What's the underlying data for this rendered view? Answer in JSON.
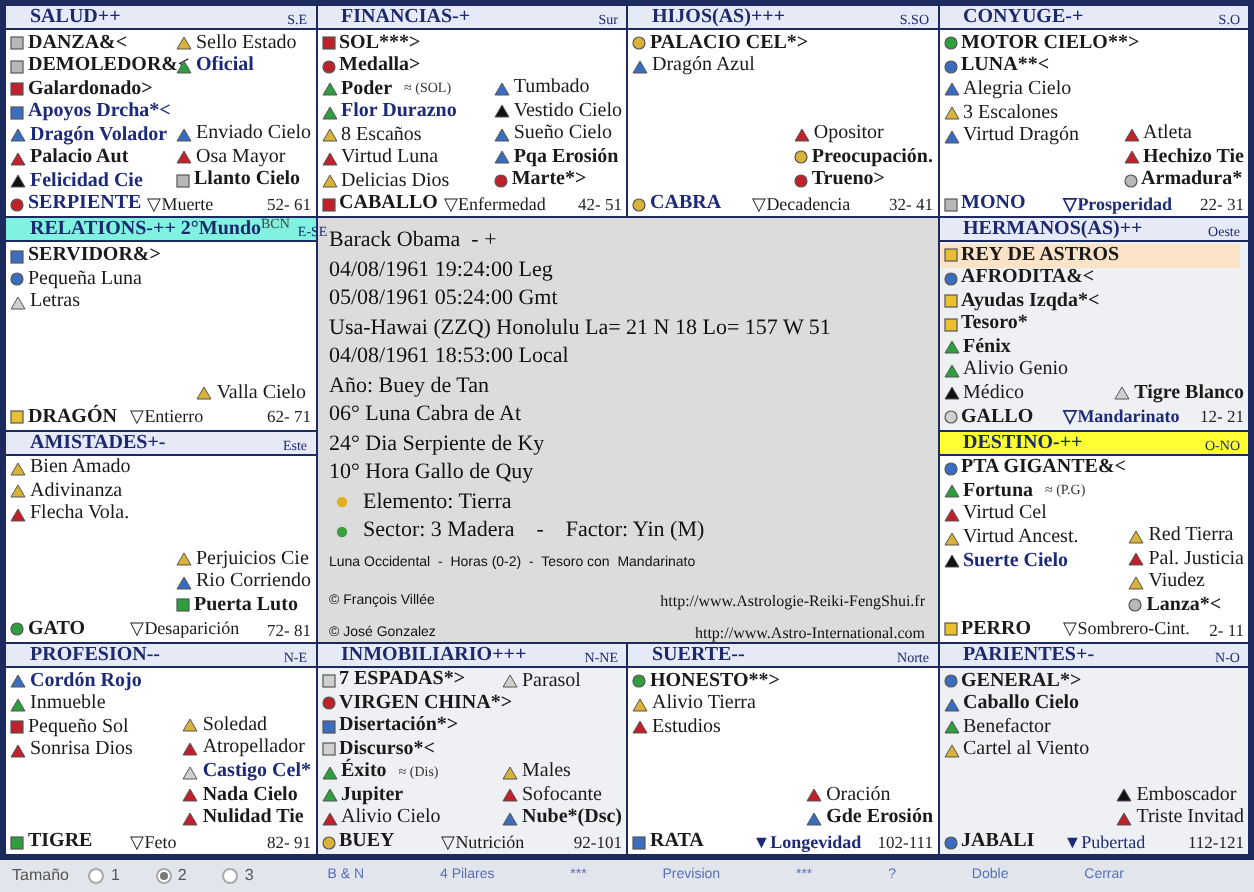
{
  "palaces": [
    {
      "title": "SALUD++",
      "direction": "S.E",
      "color": "#e6eaf7",
      "shaded": false,
      "left": [
        {
          "text": "DANZA&<",
          "kind": "square",
          "color": "#b8b8b8",
          "major": true,
          "accent": false
        },
        {
          "text": "DEMOLEDOR&<",
          "kind": "square",
          "color": "#b8b8b8",
          "major": true,
          "accent": false
        },
        {
          "text": "Galardonado>",
          "kind": "square",
          "color": "#c0202a",
          "major": true,
          "accent": false
        },
        {
          "text": "Apoyos Drcha*<",
          "kind": "square",
          "color": "#3a6cc0",
          "major": true,
          "accent": true
        },
        {
          "text": "Dragón Volador",
          "kind": "triangle",
          "color": "#3a6cc0",
          "major": true,
          "accent": true
        },
        {
          "text": "Palacio Aut",
          "kind": "triangle",
          "color": "#c0202a",
          "major": true,
          "accent": false
        },
        {
          "text": "Felicidad Cie",
          "kind": "triangle",
          "color": "#111111",
          "major": true,
          "accent": true
        }
      ],
      "right_top": [
        {
          "text": "Sello Estado",
          "kind": "triangle",
          "color": "#d9b23a",
          "major": false,
          "accent": false
        },
        {
          "text": "Oficial",
          "kind": "triangle",
          "color": "#2e9e3e",
          "major": true,
          "accent": true
        }
      ],
      "right_bottom": [
        {
          "text": "Enviado Cielo",
          "kind": "triangle",
          "color": "#3a6cc0",
          "major": false,
          "accent": false
        },
        {
          "text": "Osa Mayor",
          "kind": "triangle",
          "color": "#c0202a",
          "major": false,
          "accent": false
        },
        {
          "text": "Llanto Cielo",
          "kind": "square",
          "color": "#b8b8b8",
          "major": true,
          "accent": false
        }
      ],
      "footer": {
        "animal": {
          "text": "SERPIENTE",
          "kind": "circle",
          "color": "#c0202a",
          "major": true,
          "accent": true
        },
        "stage": {
          "text": "▽Muerte",
          "major": false,
          "accent": false
        },
        "range": "52- 61"
      }
    },
    {
      "title": "FINANCIAS-+",
      "direction": "Sur",
      "color": "#e6eaf7",
      "shaded": false,
      "left": [
        {
          "text": "SOL***>",
          "kind": "square",
          "color": "#c0202a",
          "major": true,
          "accent": false
        },
        {
          "text": "Medalla>",
          "kind": "circle",
          "color": "#c0202a",
          "major": true,
          "accent": false
        },
        {
          "text": "Poder",
          "kind": "triangle",
          "color": "#2e9e3e",
          "major": true,
          "accent": false,
          "note": "≈ (SOL)"
        },
        {
          "text": "Flor Durazno",
          "kind": "triangle",
          "color": "#2e9e3e",
          "major": true,
          "accent": true
        },
        {
          "text": "8 Escaños",
          "kind": "triangle",
          "color": "#d9b23a",
          "major": false,
          "accent": false
        },
        {
          "text": "Virtud Luna",
          "kind": "triangle",
          "color": "#c0202a",
          "major": false,
          "accent": false
        },
        {
          "text": "Delicias Dios",
          "kind": "triangle",
          "color": "#d9b23a",
          "major": false,
          "accent": false
        }
      ],
      "right_bottom": [
        {
          "text": "Tumbado",
          "kind": "triangle",
          "color": "#3a6cc0",
          "major": false,
          "accent": false
        },
        {
          "text": "Vestido Cielo",
          "kind": "triangle",
          "color": "#111111",
          "major": false,
          "accent": false
        },
        {
          "text": "Sueño Cielo",
          "kind": "triangle",
          "color": "#3a6cc0",
          "major": false,
          "accent": false
        },
        {
          "text": "Pqa Erosión",
          "kind": "triangle",
          "color": "#3a6cc0",
          "major": true,
          "accent": false
        },
        {
          "text": "Marte*>",
          "kind": "circle",
          "color": "#c0202a",
          "major": true,
          "accent": false
        }
      ],
      "footer": {
        "animal": {
          "text": "CABALLO",
          "kind": "square",
          "color": "#c0202a",
          "major": true,
          "accent": false
        },
        "stage": {
          "text": "▽Enfermedad",
          "major": false,
          "accent": false
        },
        "range": "42- 51"
      }
    },
    {
      "title": "HIJOS(AS)+++",
      "direction": "S.SO",
      "color": "#e6eaf7",
      "shaded": false,
      "left": [
        {
          "text": "PALACIO CEL*>",
          "kind": "circle",
          "color": "#d9b23a",
          "major": true,
          "accent": false
        },
        {
          "text": "Dragón Azul",
          "kind": "triangle",
          "color": "#3a6cc0",
          "major": false,
          "accent": false
        }
      ],
      "right_bottom": [
        {
          "text": "Opositor",
          "kind": "triangle",
          "color": "#c0202a",
          "major": false,
          "accent": false
        },
        {
          "text": "Preocupación.",
          "kind": "circle",
          "color": "#d9b23a",
          "major": true,
          "accent": false
        },
        {
          "text": "Trueno>",
          "kind": "circle",
          "color": "#c0202a",
          "major": true,
          "accent": false
        }
      ],
      "footer": {
        "animal": {
          "text": "CABRA",
          "kind": "circle",
          "color": "#d9b23a",
          "major": true,
          "accent": true
        },
        "stage": {
          "text": "▽Decadencia",
          "major": false,
          "accent": false
        },
        "range": "32- 41"
      }
    },
    {
      "title": "CONYUGE-+",
      "direction": "S.O",
      "color": "#e6eaf7",
      "shaded": false,
      "left": [
        {
          "text": "MOTOR CIELO**>",
          "kind": "circle",
          "color": "#2e9e3e",
          "major": true,
          "accent": false
        },
        {
          "text": "LUNA**<",
          "kind": "circle",
          "color": "#3a6cc0",
          "major": true,
          "accent": false
        },
        {
          "text": "Alegria Cielo",
          "kind": "triangle",
          "color": "#3a6cc0",
          "major": false,
          "accent": false
        },
        {
          "text": "3 Escalones",
          "kind": "triangle",
          "color": "#d9b23a",
          "major": false,
          "accent": false
        },
        {
          "text": "Virtud Dragón",
          "kind": "triangle",
          "color": "#3a6cc0",
          "major": false,
          "accent": false
        }
      ],
      "right_bottom": [
        {
          "text": "Atleta",
          "kind": "triangle",
          "color": "#c0202a",
          "major": false,
          "accent": false
        },
        {
          "text": "Hechizo Tie",
          "kind": "triangle",
          "color": "#c0202a",
          "major": true,
          "accent": false
        },
        {
          "text": "Armadura*",
          "kind": "circle",
          "color": "#b8b8b8",
          "major": true,
          "accent": false
        }
      ],
      "footer": {
        "animal": {
          "text": "MONO",
          "kind": "square",
          "color": "#b8b8b8",
          "major": true,
          "accent": true
        },
        "stage": {
          "text": "▽Prosperidad",
          "major": true,
          "accent": true
        },
        "range": "22- 31"
      }
    },
    {
      "title": "RELATIONS-++ 2°Mundo",
      "direction": "E-SE",
      "color": "#7ff3df",
      "shaded": false,
      "badge": "BCN",
      "left": [
        {
          "text": "SERVIDOR&>",
          "kind": "square",
          "color": "#3a6cc0",
          "major": true,
          "accent": false
        },
        {
          "text": "Pequeña Luna",
          "kind": "circle",
          "color": "#3a6cc0",
          "major": false,
          "accent": false
        },
        {
          "text": "Letras",
          "kind": "triangle",
          "color": "#d0d0d0",
          "major": false,
          "accent": false
        }
      ],
      "right_bottom": [
        {
          "text": "Valla Cielo",
          "kind": "triangle",
          "color": "#d9b23a",
          "major": false,
          "accent": false
        }
      ],
      "footer": {
        "animal": {
          "text": "DRAGÓN",
          "kind": "square",
          "color": "#e8c030",
          "major": true,
          "accent": false
        },
        "stage": {
          "text": "▽Entierro",
          "major": false,
          "accent": false
        },
        "range": "62- 71"
      }
    },
    {
      "title": "HERMANOS(AS)++",
      "direction": "Oeste",
      "color": "#e6eaf7",
      "shaded": true,
      "left": [
        {
          "text": "REY DE ASTROS",
          "kind": "square",
          "color": "#e8c030",
          "major": true,
          "accent": false,
          "highlighted": true
        },
        {
          "text": "AFRODITA&<",
          "kind": "circle",
          "color": "#3a6cc0",
          "major": true,
          "accent": false,
          "highlighted": false
        },
        {
          "text": "Ayudas Izqda*<",
          "kind": "square",
          "color": "#e8c030",
          "major": true,
          "accent": false,
          "highlighted": false
        },
        {
          "text": "Tesoro*",
          "kind": "square",
          "color": "#e8c030",
          "major": true,
          "accent": false,
          "highlighted": false
        },
        {
          "text": "Fénix",
          "kind": "triangle",
          "color": "#2e9e3e",
          "major": true,
          "accent": false,
          "highlighted": false
        },
        {
          "text": "Alivio Genio",
          "kind": "triangle",
          "color": "#2e9e3e",
          "major": false,
          "accent": false,
          "highlighted": false
        },
        {
          "text": "Médico",
          "kind": "triangle",
          "color": "#111111",
          "major": false,
          "accent": false,
          "highlighted": false
        }
      ],
      "right_bottom": [
        {
          "text": "Tigre Blanco",
          "kind": "triangle",
          "color": "#d0d0d0",
          "major": true,
          "accent": false
        }
      ],
      "footer": {
        "animal": {
          "text": "GALLO",
          "kind": "circle",
          "color": "#d0d0d0",
          "major": true,
          "accent": false
        },
        "stage": {
          "text": "▽Mandarinato",
          "major": true,
          "accent": true
        },
        "range": "12- 21"
      }
    },
    {
      "title": "AMISTADES+-",
      "direction": "Este",
      "color": "#e6eaf7",
      "shaded": false,
      "left": [
        {
          "text": "Bien Amado",
          "kind": "triangle",
          "color": "#d9b23a",
          "major": false,
          "accent": false
        },
        {
          "text": "Adivinanza",
          "kind": "triangle",
          "color": "#d9b23a",
          "major": false,
          "accent": false
        },
        {
          "text": "Flecha Vola.",
          "kind": "triangle",
          "color": "#c0202a",
          "major": false,
          "accent": false
        }
      ],
      "right_bottom": [
        {
          "text": "Perjuicios Cie",
          "kind": "triangle",
          "color": "#d9b23a",
          "major": false,
          "accent": false
        },
        {
          "text": "Rio Corriendo",
          "kind": "triangle",
          "color": "#3a6cc0",
          "major": false,
          "accent": false
        },
        {
          "text": "Puerta Luto",
          "kind": "square",
          "color": "#2e9e3e",
          "major": true,
          "accent": false
        }
      ],
      "footer": {
        "animal": {
          "text": "GATO",
          "kind": "circle",
          "color": "#2e9e3e",
          "major": true,
          "accent": false
        },
        "stage": {
          "text": "▽Desaparición",
          "major": false,
          "accent": false
        },
        "range": "72- 81"
      }
    },
    {
      "title": "DESTINO-++",
      "direction": "O-NO",
      "color": "#ffff33",
      "shaded": false,
      "left": [
        {
          "text": "PTA GIGANTE&<",
          "kind": "circle",
          "color": "#3a6cc0",
          "major": true,
          "accent": false
        },
        {
          "text": "Fortuna",
          "kind": "triangle",
          "color": "#2e9e3e",
          "major": true,
          "accent": false,
          "note": "≈ (P.G)"
        },
        {
          "text": "Virtud Cel",
          "kind": "triangle",
          "color": "#c0202a",
          "major": false,
          "accent": false
        },
        {
          "text": "Virtud Ancest.",
          "kind": "triangle",
          "color": "#d9b23a",
          "major": false,
          "accent": false
        },
        {
          "text": "Suerte Cielo",
          "kind": "triangle",
          "color": "#111111",
          "major": true,
          "accent": true
        }
      ],
      "right_bottom": [
        {
          "text": "Red Tierra",
          "kind": "triangle",
          "color": "#d9b23a",
          "major": false,
          "accent": false
        },
        {
          "text": "Pal. Justicia",
          "kind": "triangle",
          "color": "#c0202a",
          "major": false,
          "accent": false
        },
        {
          "text": "Viudez",
          "kind": "triangle",
          "color": "#d9b23a",
          "major": false,
          "accent": false
        },
        {
          "text": "Lanza*<",
          "kind": "circle",
          "color": "#b8b8b8",
          "major": true,
          "accent": false
        }
      ],
      "footer": {
        "animal": {
          "text": "PERRO",
          "kind": "square",
          "color": "#e8c030",
          "major": true,
          "accent": false
        },
        "stage": {
          "text": "▽Sombrero-Cint.",
          "major": false,
          "accent": false
        },
        "range": "2- 11"
      }
    },
    {
      "title": "PROFESION--",
      "direction": "N-E",
      "color": "#e6eaf7",
      "shaded": false,
      "left": [
        {
          "text": "Cordón Rojo",
          "kind": "triangle",
          "color": "#3a6cc0",
          "major": true,
          "accent": true
        },
        {
          "text": "Inmueble",
          "kind": "triangle",
          "color": "#2e9e3e",
          "major": false,
          "accent": false
        },
        {
          "text": "Pequeño Sol",
          "kind": "square",
          "color": "#c0202a",
          "major": false,
          "accent": false
        },
        {
          "text": "Sonrisa Dios",
          "kind": "triangle",
          "color": "#c0202a",
          "major": false,
          "accent": false
        }
      ],
      "right_bottom": [
        {
          "text": "Soledad",
          "kind": "triangle",
          "color": "#d9b23a",
          "major": false,
          "accent": false
        },
        {
          "text": "Atropellador",
          "kind": "triangle",
          "color": "#c0202a",
          "major": false,
          "accent": false
        },
        {
          "text": "Castigo Cel*",
          "kind": "triangle",
          "color": "#d0d0d0",
          "major": true,
          "accent": true
        },
        {
          "text": "Nada Cielo",
          "kind": "triangle",
          "color": "#c0202a",
          "major": true,
          "accent": false
        },
        {
          "text": "Nulidad Tie",
          "kind": "triangle",
          "color": "#c0202a",
          "major": true,
          "accent": false
        }
      ],
      "footer": {
        "animal": {
          "text": "TIGRE",
          "kind": "square",
          "color": "#2e9e3e",
          "major": true,
          "accent": false
        },
        "stage": {
          "text": "▽Feto",
          "major": false,
          "accent": false
        },
        "range": "82- 91"
      }
    },
    {
      "title": "INMOBILIARIO+++",
      "direction": "N-NE",
      "color": "#e6eaf7",
      "shaded": true,
      "left": [
        {
          "text": "7 ESPADAS*>",
          "kind": "square",
          "color": "#d0d0d0",
          "major": true,
          "accent": false
        },
        {
          "text": "VIRGEN CHINA*>",
          "kind": "circle",
          "color": "#c0202a",
          "major": true,
          "accent": false
        },
        {
          "text": "Disertación*>",
          "kind": "square",
          "color": "#3a6cc0",
          "major": true,
          "accent": false
        },
        {
          "text": "Discurso*<",
          "kind": "square",
          "color": "#d0d0d0",
          "major": true,
          "accent": false
        },
        {
          "text": "Éxito",
          "kind": "triangle",
          "color": "#2e9e3e",
          "major": true,
          "accent": false,
          "note": "≈ (Dis)"
        },
        {
          "text": "Jupiter",
          "kind": "triangle",
          "color": "#2e9e3e",
          "major": true,
          "accent": false
        },
        {
          "text": "Alivio Cielo",
          "kind": "triangle",
          "color": "#c0202a",
          "major": false,
          "accent": false
        }
      ],
      "right_top": [
        {
          "text": "Parasol",
          "kind": "triangle",
          "color": "#d0d0d0",
          "major": false,
          "accent": false
        }
      ],
      "right_bottom": [
        {
          "text": "Males",
          "kind": "triangle",
          "color": "#d9b23a",
          "major": false,
          "accent": false
        },
        {
          "text": "Sofocante",
          "kind": "triangle",
          "color": "#c0202a",
          "major": false,
          "accent": false
        },
        {
          "text": "Nube*(Dsc)",
          "kind": "triangle",
          "color": "#3a6cc0",
          "major": true,
          "accent": false
        }
      ],
      "footer": {
        "animal": {
          "text": "BUEY",
          "kind": "circle",
          "color": "#d9b23a",
          "major": true,
          "accent": false
        },
        "stage": {
          "text": "▽Nutrición",
          "major": false,
          "accent": false
        },
        "range": "92-101"
      }
    },
    {
      "title": "SUERTE--",
      "direction": "Norte",
      "color": "#e6eaf7",
      "shaded": false,
      "left": [
        {
          "text": "HONESTO**>",
          "kind": "circle",
          "color": "#2e9e3e",
          "major": true,
          "accent": false
        },
        {
          "text": "Alivio Tierra",
          "kind": "triangle",
          "color": "#d9b23a",
          "major": false,
          "accent": false
        },
        {
          "text": "Estudios",
          "kind": "triangle",
          "color": "#c0202a",
          "major": false,
          "accent": false
        }
      ],
      "right_bottom": [
        {
          "text": "Oración",
          "kind": "triangle",
          "color": "#c0202a",
          "major": false,
          "accent": false
        },
        {
          "text": "Gde Erosión",
          "kind": "triangle",
          "color": "#3a6cc0",
          "major": true,
          "accent": false
        }
      ],
      "footer": {
        "animal": {
          "text": "RATA",
          "kind": "square",
          "color": "#3a6cc0",
          "major": true,
          "accent": false
        },
        "stage": {
          "text": "▼Longevidad",
          "major": true,
          "accent": true
        },
        "range": "102-111"
      }
    },
    {
      "title": "PARIENTES+-",
      "direction": "N-O",
      "color": "#e6eaf7",
      "shaded": true,
      "left": [
        {
          "text": "GENERAL*>",
          "kind": "circle",
          "color": "#3a6cc0",
          "major": true,
          "accent": false
        },
        {
          "text": "Caballo Cielo",
          "kind": "triangle",
          "color": "#3a6cc0",
          "major": true,
          "accent": false
        },
        {
          "text": "Benefactor",
          "kind": "triangle",
          "color": "#2e9e3e",
          "major": false,
          "accent": false
        },
        {
          "text": "Cartel al Viento",
          "kind": "triangle",
          "color": "#d9b23a",
          "major": false,
          "accent": false
        }
      ],
      "right_bottom": [
        {
          "text": "Emboscador",
          "kind": "triangle",
          "color": "#111111",
          "major": false,
          "accent": false
        },
        {
          "text": "Triste Invitad",
          "kind": "triangle",
          "color": "#c0202a",
          "major": false,
          "accent": false
        }
      ],
      "footer": {
        "animal": {
          "text": "JABALI",
          "kind": "circle",
          "color": "#3a6cc0",
          "major": true,
          "accent": false
        },
        "stage": {
          "text": "▼Pubertad",
          "major": false,
          "accent": true
        },
        "range": "112-121"
      }
    }
  ],
  "center": {
    "lines": [
      "Barack Obama  - +",
      "04/08/1961 19:24:00 Leg",
      "05/08/1961 05:24:00 Gmt",
      "Usa-Hawai (ZZQ) Honolulu La= 21 N 18 Lo= 157 W 51",
      "04/08/1961 18:53:00 Local",
      "Año: Buey de Tan",
      "06° Luna Cabra de At",
      "24° Dia Serpiente de Ky",
      "10° Hora Gallo de Quy"
    ],
    "elements": [
      {
        "text": "Elemento: Tierra",
        "color": "#e0b020"
      },
      {
        "text": "Sector: 3 Madera    -    Factor: Yin (M)",
        "color": "#3aa040"
      }
    ],
    "note": "Luna Occidental  -  Horas (0-2)  -  Tesoro con  Mandarinato",
    "credits": [
      {
        "author": "© François Villée",
        "url": "http://www.Astrologie-Reiki-FengShui.fr"
      },
      {
        "author": "© José Gonzalez",
        "url": "http://www.Astro-International.com"
      }
    ]
  },
  "bottom_bar": {
    "size_label": "Tamaño",
    "sizes": [
      {
        "label": "1",
        "selected": false
      },
      {
        "label": "2",
        "selected": true
      },
      {
        "label": "3",
        "selected": false
      }
    ],
    "links": [
      "B & N",
      "4 Pilares",
      "***",
      "Prevision",
      "***",
      "?",
      "Doble",
      "Cerrar"
    ]
  }
}
